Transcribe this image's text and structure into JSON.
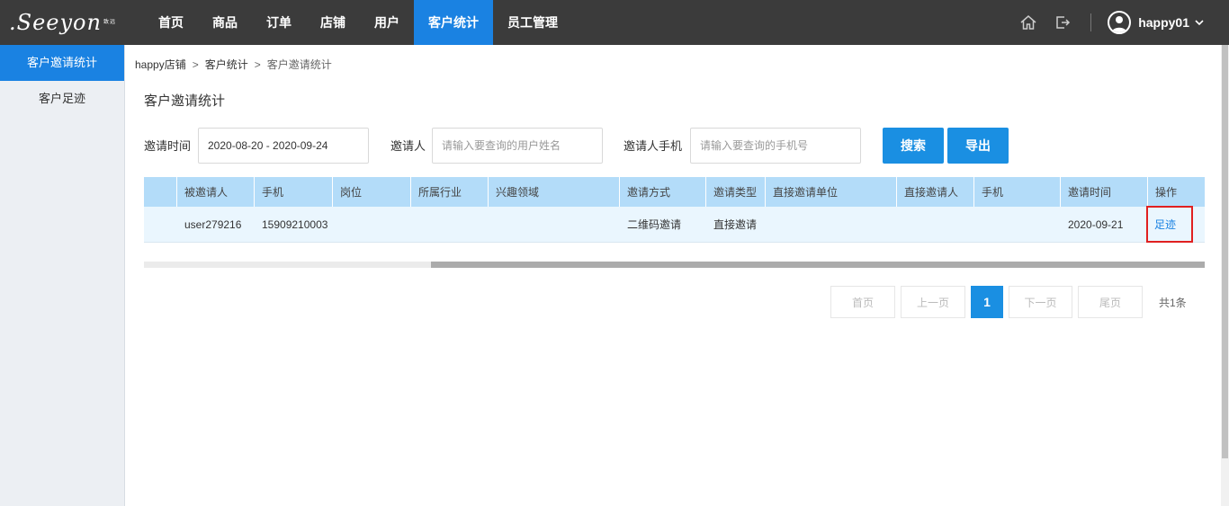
{
  "header": {
    "logo_text": ".Seeyon",
    "logo_sub": "致远",
    "nav": [
      {
        "label": "首页",
        "active": false
      },
      {
        "label": "商品",
        "active": false
      },
      {
        "label": "订单",
        "active": false
      },
      {
        "label": "店铺",
        "active": false
      },
      {
        "label": "用户",
        "active": false
      },
      {
        "label": "客户统计",
        "active": true
      },
      {
        "label": "员工管理",
        "active": false
      }
    ],
    "icons": [
      "home-icon",
      "logout-icon"
    ],
    "username": "happy01"
  },
  "sidebar": {
    "items": [
      {
        "label": "客户邀请统计",
        "active": true
      },
      {
        "label": "客户足迹",
        "active": false
      }
    ]
  },
  "breadcrumb": {
    "items": [
      "happy店铺",
      "客户统计",
      "客户邀请统计"
    ]
  },
  "page_title": "客户邀请统计",
  "filters": {
    "time_label": "邀请时间",
    "time_value": "2020-08-20 - 2020-09-24",
    "inviter_label": "邀请人",
    "inviter_placeholder": "请输入要查询的用户姓名",
    "phone_label": "邀请人手机",
    "phone_placeholder": "请输入要查询的手机号",
    "search_label": "搜索",
    "export_label": "导出"
  },
  "table": {
    "columns": [
      "",
      "被邀请人",
      "手机",
      "岗位",
      "所属行业",
      "兴趣领域",
      "邀请方式",
      "邀请类型",
      "直接邀请单位",
      "直接邀请人",
      "手机",
      "邀请时间",
      "操作"
    ],
    "rows": [
      [
        "",
        "user279216",
        "15909210003",
        "",
        "",
        "",
        "二维码邀请",
        "直接邀请",
        "",
        "",
        "",
        "2020-09-21",
        "足迹"
      ]
    ]
  },
  "pagination": {
    "first": "首页",
    "prev": "上一页",
    "current": "1",
    "next": "下一页",
    "last": "尾页",
    "total": "共1条"
  },
  "colors": {
    "accent": "#1a82e2",
    "topbar": "#3b3b3b",
    "table_header": "#b3dcf9",
    "table_row": "#eaf6fe",
    "highlight": "#e02020"
  }
}
